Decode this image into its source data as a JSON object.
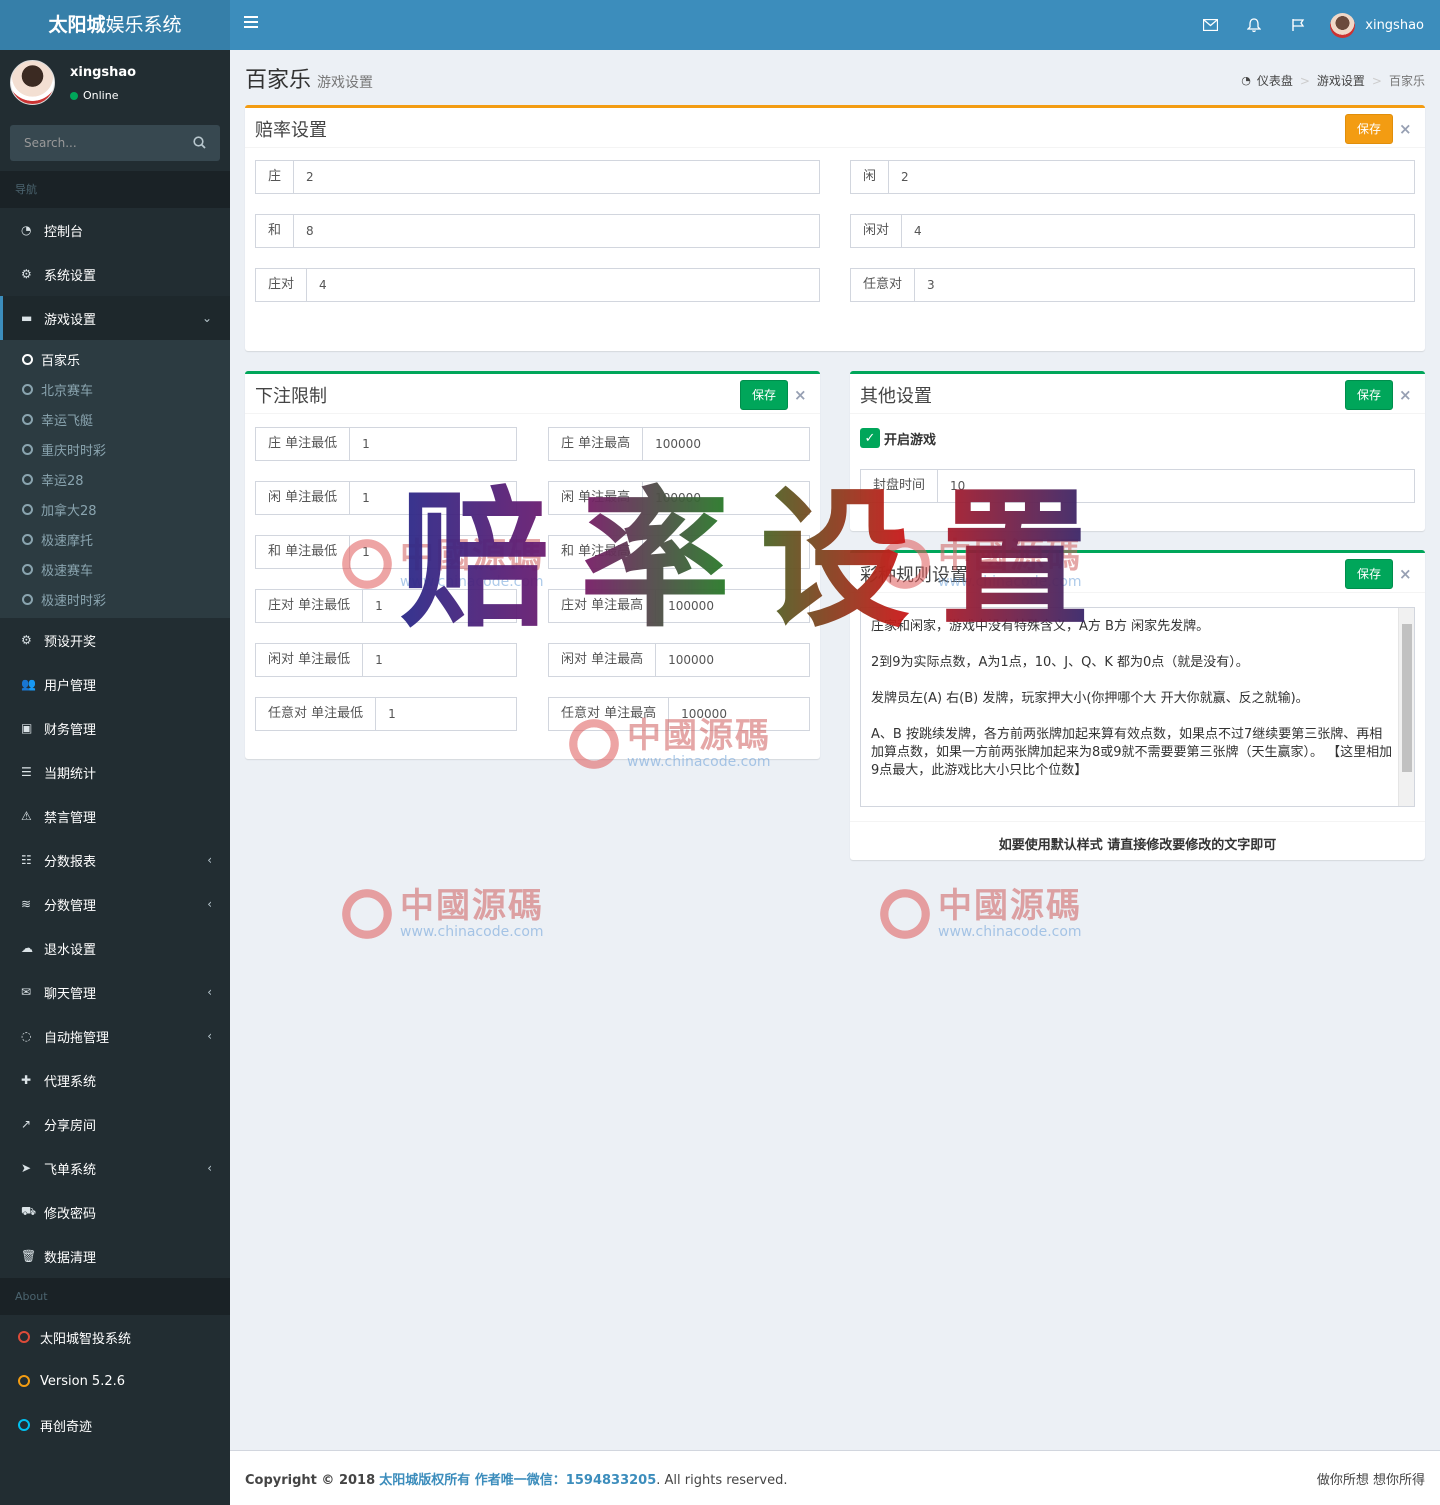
{
  "header": {
    "logo_bold": "太阳城",
    "logo_rest": "娱乐系统",
    "username": "xingshao"
  },
  "sidebar": {
    "user_name": "xingshao",
    "status": "Online",
    "search_placeholder": "Search...",
    "nav_header": "导航",
    "items": [
      {
        "label": "控制台",
        "icon": "dashboard-icon"
      },
      {
        "label": "系统设置",
        "icon": "cogs-icon"
      },
      {
        "label": "游戏设置",
        "icon": "gamepad-icon"
      },
      {
        "label": "预设开奖",
        "icon": "gear-icon"
      },
      {
        "label": "用户管理",
        "icon": "users-icon"
      },
      {
        "label": "财务管理",
        "icon": "money-icon"
      },
      {
        "label": "当期统计",
        "icon": "list-icon"
      },
      {
        "label": "禁言管理",
        "icon": "warning-icon"
      },
      {
        "label": "分数报表",
        "icon": "list-ol-icon"
      },
      {
        "label": "分数管理",
        "icon": "database-icon"
      },
      {
        "label": "退水设置",
        "icon": "cloud-download-icon"
      },
      {
        "label": "聊天管理",
        "icon": "comments-icon"
      },
      {
        "label": "自动拖管理",
        "icon": "commenting-icon"
      },
      {
        "label": "代理系统",
        "icon": "user-plus-icon"
      },
      {
        "label": "分享房间",
        "icon": "share-icon"
      },
      {
        "label": "飞单系统",
        "icon": "paper-plane-icon"
      },
      {
        "label": "修改密码",
        "icon": "cart-icon"
      },
      {
        "label": "数据清理",
        "icon": "trash-icon"
      }
    ],
    "game_sub": [
      "百家乐",
      "北京赛车",
      "幸运飞艇",
      "重庆时时彩",
      "幸运28",
      "加拿大28",
      "极速摩托",
      "极速赛车",
      "极速时时彩"
    ],
    "about_header": "About",
    "about": [
      {
        "label": "太阳城智投系统",
        "color": "#dd4b39"
      },
      {
        "label": "Version 5.2.6",
        "color": "#f39c12"
      },
      {
        "label": "再创奇迹",
        "color": "#00c0ef"
      }
    ]
  },
  "page": {
    "title": "百家乐",
    "subtitle": "游戏设置",
    "breadcrumb": [
      "仪表盘",
      "游戏设置",
      "百家乐"
    ]
  },
  "odds": {
    "title": "赔率设置",
    "save": "保存",
    "close": "×",
    "fields": [
      {
        "label": "庄",
        "value": "2"
      },
      {
        "label": "闲",
        "value": "2"
      },
      {
        "label": "和",
        "value": "8"
      },
      {
        "label": "闲对",
        "value": "4"
      },
      {
        "label": "庄对",
        "value": "4"
      },
      {
        "label": "任意对",
        "value": "3"
      }
    ]
  },
  "limits": {
    "title": "下注限制",
    "save": "保存",
    "close": "×",
    "rows": [
      {
        "min_label": "庄 单注最低",
        "min": "1",
        "max_label": "庄 单注最高",
        "max": "100000"
      },
      {
        "min_label": "闲 单注最低",
        "min": "1",
        "max_label": "闲 单注最高",
        "max": "100000"
      },
      {
        "min_label": "和 单注最低",
        "min": "1",
        "max_label": "和 单注最高",
        "max": ""
      },
      {
        "min_label": "庄对 单注最低",
        "min": "1",
        "max_label": "庄对 单注最高",
        "max": "100000"
      },
      {
        "min_label": "闲对 单注最低",
        "min": "1",
        "max_label": "闲对 单注最高",
        "max": "100000"
      },
      {
        "min_label": "任意对 单注最低",
        "min": "1",
        "max_label": "任意对 单注最高",
        "max": "100000"
      }
    ]
  },
  "other": {
    "title": "其他设置",
    "save": "保存",
    "close": "×",
    "enable_label": "开启游戏",
    "close_time_label": "封盘时间",
    "close_time": "10"
  },
  "rules": {
    "title": "彩种规则设置",
    "save": "保存",
    "close": "×",
    "paragraphs": [
      "庄家和闲家，游戏中没有特殊含义，A方 B方 闲家先发牌。",
      "2到9为实际点数，A为1点，10、J、Q、K 都为0点（就是没有）。",
      "发牌员左(A) 右(B) 发牌，玩家押大小(你押哪个大 开大你就赢、反之就输)。",
      "A、B 按跳续发牌，各方前两张牌加起来算有效点数，如果点不过7继续要第三张牌、再相加算点数，如果一方前两张牌加起来为8或9就不需要要第三张牌（天生赢家）。 【这里相加9点最大，此游戏比大小只比个位数】"
    ],
    "footer": "如要使用默认样式 请直接修改要修改的文字即可"
  },
  "watermark": {
    "big": "赔率设置",
    "cn": "中國源碼",
    "url": "www.chinacode.com"
  },
  "footer": {
    "copyright": "Copyright © 2018",
    "owner": "太阳城版权所有 作者唯一微信：1594833205",
    "rights": ". All rights reserved.",
    "slogan": "做你所想 想你所得"
  }
}
